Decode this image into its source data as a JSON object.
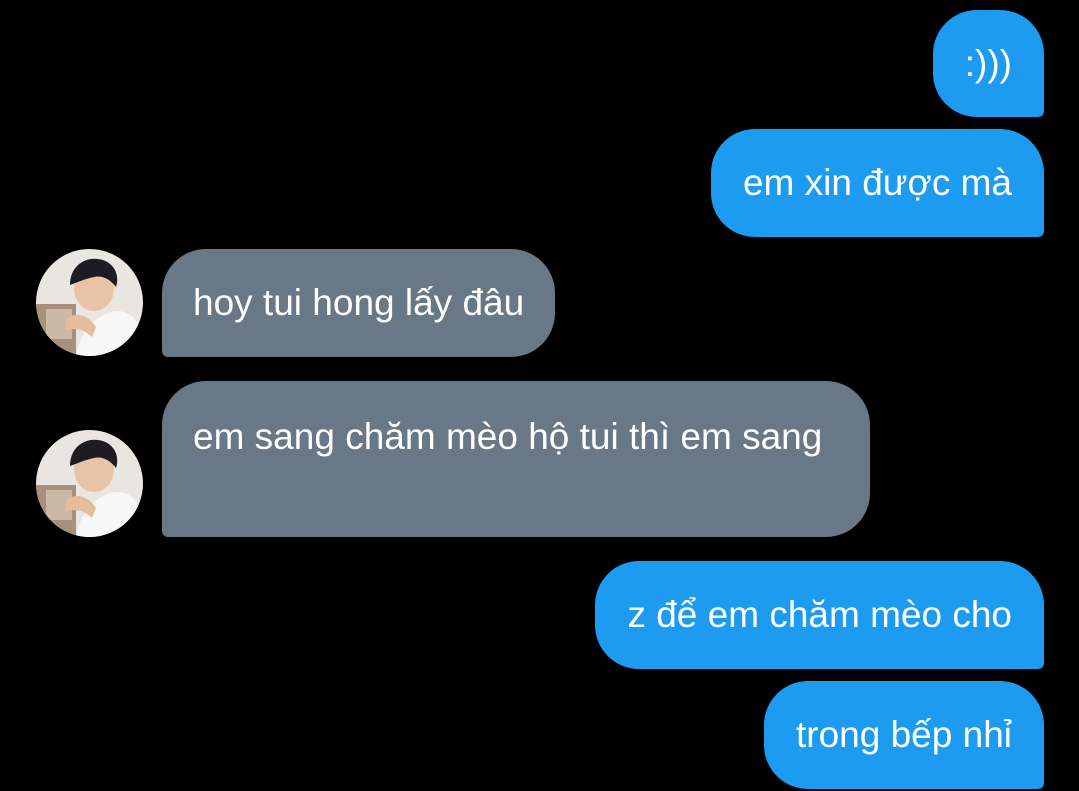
{
  "messages": [
    {
      "from": "me",
      "text": ":)))"
    },
    {
      "from": "me",
      "text": "em xin được mà"
    },
    {
      "from": "them",
      "text": "hoy tui hong lấy đâu"
    },
    {
      "from": "them",
      "text": "em sang chăm mèo hộ tui thì em sang"
    },
    {
      "from": "me",
      "text": "z để em chăm mèo cho"
    },
    {
      "from": "me",
      "text": "trong bếp nhỉ"
    }
  ],
  "colors": {
    "background": "#000000",
    "sent_bubble": "#1d9bf0",
    "received_bubble": "#697886",
    "text": "#ffffff"
  },
  "icons": {
    "avatar": "contact-avatar-photo"
  }
}
